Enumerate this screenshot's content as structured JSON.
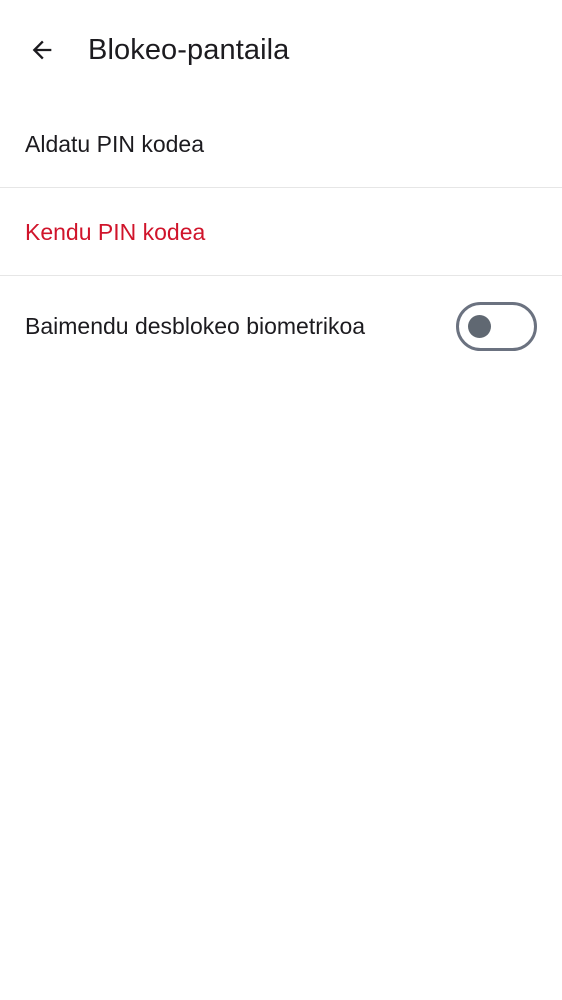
{
  "header": {
    "title": "Blokeo-pantaila",
    "back_icon": "arrow-left-icon"
  },
  "settings": {
    "change_pin_label": "Aldatu PIN kodea",
    "remove_pin_label": "Kendu PIN kodea",
    "biometric_label": "Baimendu desblokeo biometrikoa",
    "biometric_enabled": false
  },
  "colors": {
    "text_primary": "#1c1b1f",
    "danger": "#d0142b",
    "divider": "#e6e6e6",
    "switch_outline": "#6b7280",
    "switch_thumb": "#606872",
    "background": "#ffffff"
  }
}
